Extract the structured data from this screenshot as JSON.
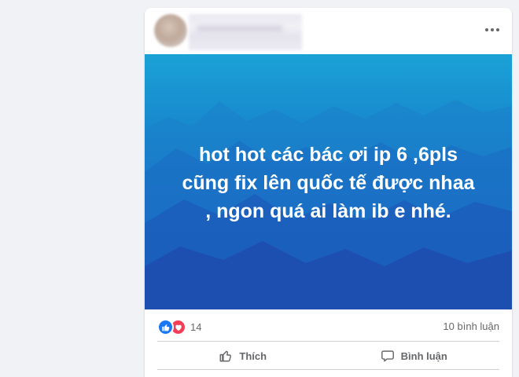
{
  "post": {
    "image_text": {
      "line1": "hot hot các bác ơi ip 6 ,6pls",
      "line2": "cũng fix lên quốc tế được nhaa",
      "line3": ", ngon quá ai làm ib e nhé."
    },
    "reaction_count": "14",
    "comment_count": "10 bình luận",
    "actions": {
      "like_label": "Thích",
      "comment_label": "Bình luận"
    }
  },
  "colors": {
    "like_blue": "#1877f2",
    "love_red": "#f33e58",
    "secondary_text": "#65676b"
  },
  "icons": {
    "more": "more-horizontal-icon",
    "like_reaction": "like-reaction-icon",
    "love_reaction": "love-reaction-icon",
    "like_action": "thumbs-up-icon",
    "comment_action": "comment-bubble-icon"
  }
}
